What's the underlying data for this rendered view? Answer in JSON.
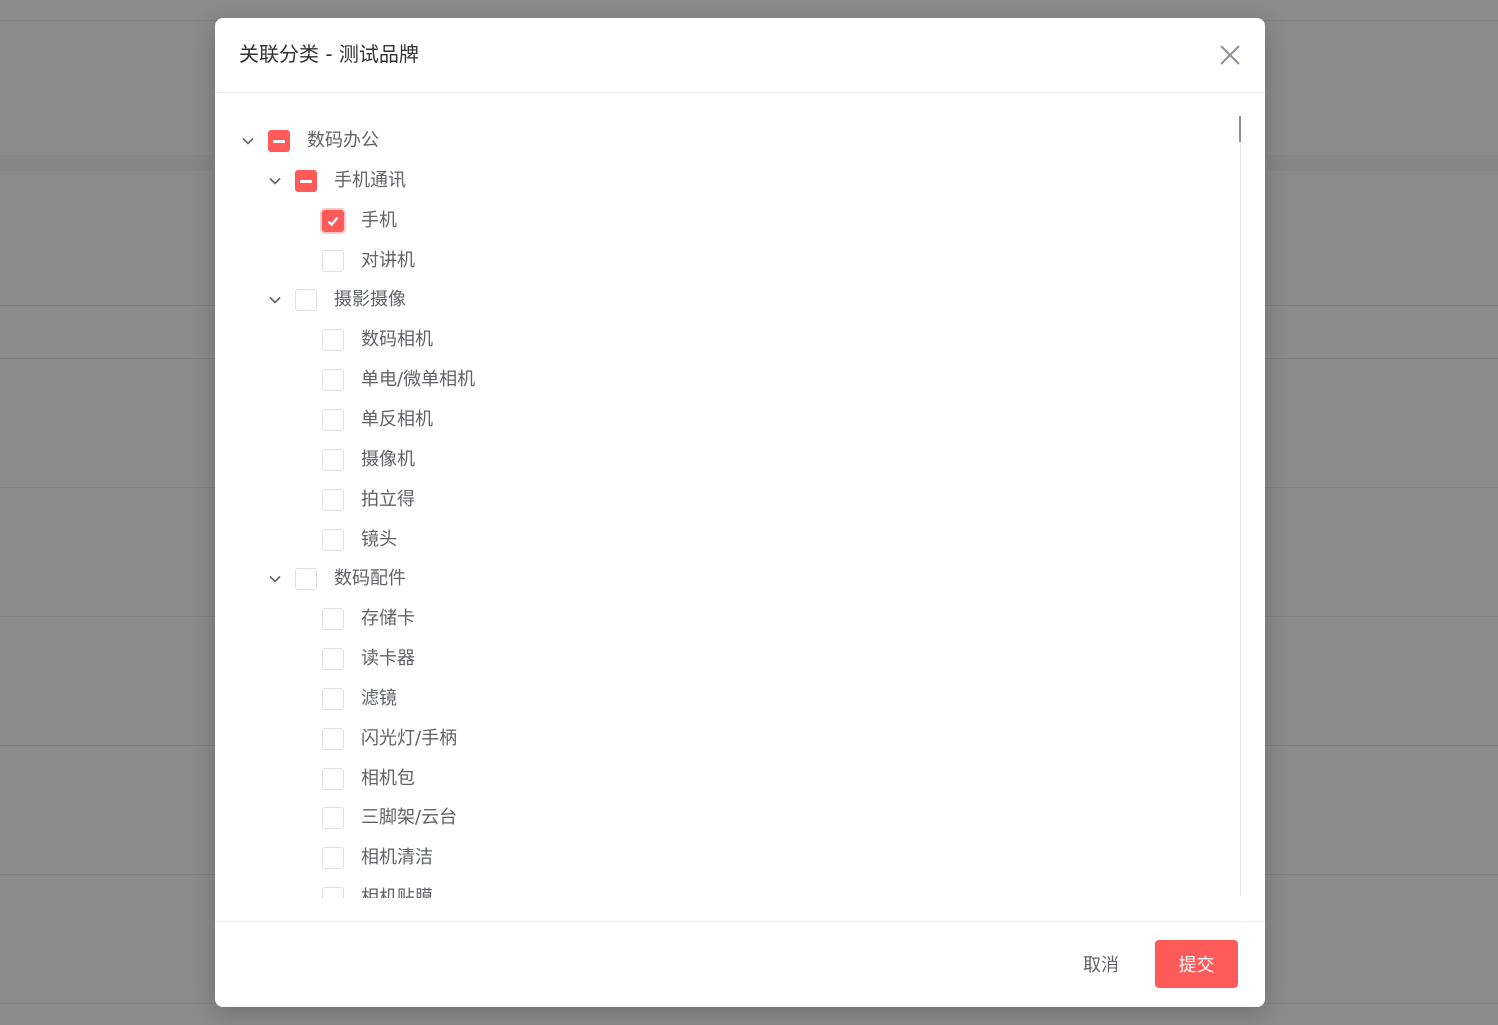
{
  "dialog": {
    "title": "关联分类 - 测试品牌",
    "close_icon": "close-icon",
    "accent_color": "#ff5a5a"
  },
  "tree": {
    "nodes": [
      {
        "label": "数码办公",
        "level": 0,
        "expandable": true,
        "expanded": true,
        "state": "indeterminate"
      },
      {
        "label": "手机通讯",
        "level": 1,
        "expandable": true,
        "expanded": true,
        "state": "indeterminate"
      },
      {
        "label": "手机",
        "level": 2,
        "expandable": false,
        "state": "checked"
      },
      {
        "label": "对讲机",
        "level": 2,
        "expandable": false,
        "state": "unchecked"
      },
      {
        "label": "摄影摄像",
        "level": 1,
        "expandable": true,
        "expanded": true,
        "state": "unchecked"
      },
      {
        "label": "数码相机",
        "level": 2,
        "expandable": false,
        "state": "unchecked"
      },
      {
        "label": "单电/微单相机",
        "level": 2,
        "expandable": false,
        "state": "unchecked"
      },
      {
        "label": "单反相机",
        "level": 2,
        "expandable": false,
        "state": "unchecked"
      },
      {
        "label": "摄像机",
        "level": 2,
        "expandable": false,
        "state": "unchecked"
      },
      {
        "label": "拍立得",
        "level": 2,
        "expandable": false,
        "state": "unchecked"
      },
      {
        "label": "镜头",
        "level": 2,
        "expandable": false,
        "state": "unchecked"
      },
      {
        "label": "数码配件",
        "level": 1,
        "expandable": true,
        "expanded": true,
        "state": "unchecked"
      },
      {
        "label": "存储卡",
        "level": 2,
        "expandable": false,
        "state": "unchecked"
      },
      {
        "label": "读卡器",
        "level": 2,
        "expandable": false,
        "state": "unchecked"
      },
      {
        "label": "滤镜",
        "level": 2,
        "expandable": false,
        "state": "unchecked"
      },
      {
        "label": "闪光灯/手柄",
        "level": 2,
        "expandable": false,
        "state": "unchecked"
      },
      {
        "label": "相机包",
        "level": 2,
        "expandable": false,
        "state": "unchecked"
      },
      {
        "label": "三脚架/云台",
        "level": 2,
        "expandable": false,
        "state": "unchecked"
      },
      {
        "label": "相机清洁",
        "level": 2,
        "expandable": false,
        "state": "unchecked"
      },
      {
        "label": "相机贴膜",
        "level": 2,
        "expandable": false,
        "state": "unchecked"
      }
    ]
  },
  "footer": {
    "cancel_label": "取消",
    "submit_label": "提交"
  }
}
